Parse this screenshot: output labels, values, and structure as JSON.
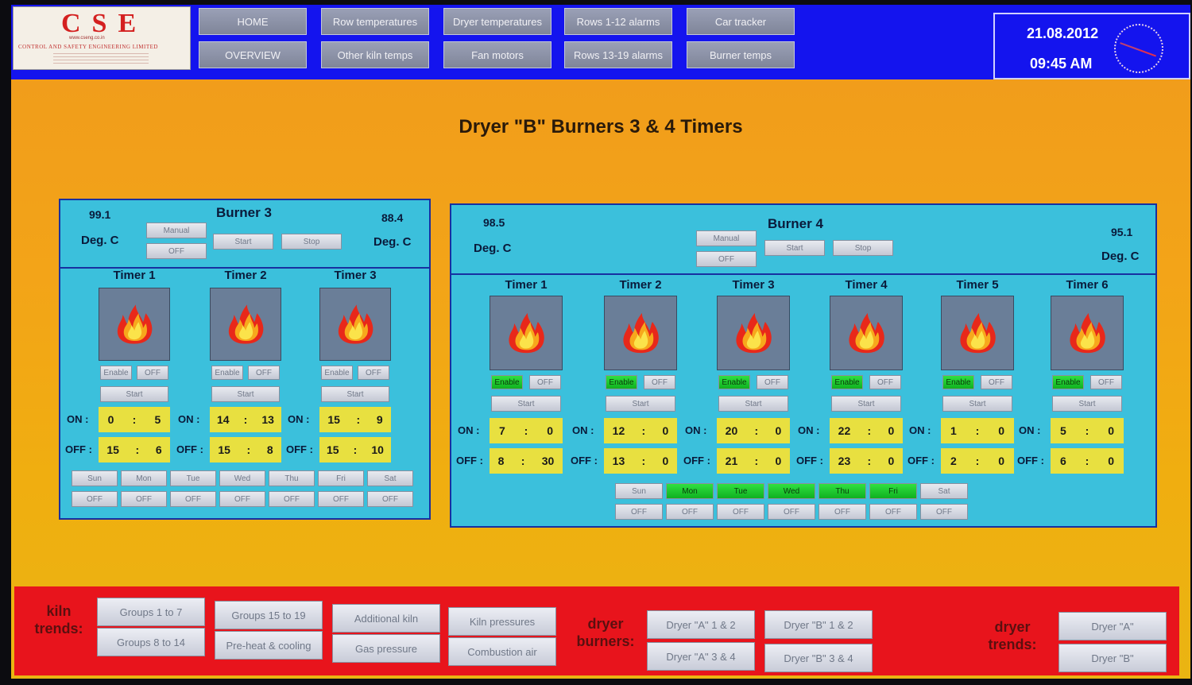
{
  "logo": {
    "letters": "CSE",
    "url": "www.cseng.co.in",
    "company": "CONTROL AND SAFETY ENGINEERING LIMITED"
  },
  "nav": [
    {
      "label": "HOME"
    },
    {
      "label": "Row temperatures"
    },
    {
      "label": "Dryer temperatures"
    },
    {
      "label": "Rows 1-12 alarms"
    },
    {
      "label": "Car tracker"
    },
    {
      "label": "OVERVIEW"
    },
    {
      "label": "Other kiln temps"
    },
    {
      "label": "Fan motors"
    },
    {
      "label": "Rows 13-19 alarms"
    },
    {
      "label": "Burner temps"
    }
  ],
  "clock": {
    "date": "21.08.2012",
    "time": "09:45 AM"
  },
  "page_title": "Dryer \"B\" Burners 3 & 4 Timers",
  "labels": {
    "on": "ON :",
    "off": "OFF :",
    "colon": ":",
    "deg": "Deg. C",
    "manual": "Manual",
    "off_btn": "OFF",
    "start": "Start",
    "stop": "Stop",
    "enable": "Enable"
  },
  "burner3": {
    "title": "Burner 3",
    "temp_left": "99.1",
    "temp_right": "88.4",
    "timers": [
      {
        "name": "Timer 1",
        "on_h": "0",
        "on_m": "5",
        "off_h": "15",
        "off_m": "6"
      },
      {
        "name": "Timer 2",
        "on_h": "14",
        "on_m": "13",
        "off_h": "15",
        "off_m": "8"
      },
      {
        "name": "Timer 3",
        "on_h": "15",
        "on_m": "9",
        "off_h": "15",
        "off_m": "10"
      }
    ],
    "days": [
      {
        "day": "Sun",
        "active": false
      },
      {
        "day": "Mon",
        "active": false
      },
      {
        "day": "Tue",
        "active": false
      },
      {
        "day": "Wed",
        "active": false
      },
      {
        "day": "Thu",
        "active": false
      },
      {
        "day": "Fri",
        "active": false
      },
      {
        "day": "Sat",
        "active": false
      }
    ]
  },
  "burner4": {
    "title": "Burner 4",
    "temp_left": "98.5",
    "temp_right": "95.1",
    "timers": [
      {
        "name": "Timer 1",
        "on_h": "7",
        "on_m": "0",
        "off_h": "8",
        "off_m": "30"
      },
      {
        "name": "Timer 2",
        "on_h": "12",
        "on_m": "0",
        "off_h": "13",
        "off_m": "0"
      },
      {
        "name": "Timer 3",
        "on_h": "20",
        "on_m": "0",
        "off_h": "21",
        "off_m": "0"
      },
      {
        "name": "Timer 4",
        "on_h": "22",
        "on_m": "0",
        "off_h": "23",
        "off_m": "0"
      },
      {
        "name": "Timer 5",
        "on_h": "1",
        "on_m": "0",
        "off_h": "2",
        "off_m": "0"
      },
      {
        "name": "Timer 6",
        "on_h": "5",
        "on_m": "0",
        "off_h": "6",
        "off_m": "0"
      }
    ],
    "days": [
      {
        "day": "Sun",
        "active": false
      },
      {
        "day": "Mon",
        "active": true
      },
      {
        "day": "Tue",
        "active": true
      },
      {
        "day": "Wed",
        "active": true
      },
      {
        "day": "Thu",
        "active": true
      },
      {
        "day": "Fri",
        "active": true
      },
      {
        "day": "Sat",
        "active": false
      }
    ]
  },
  "bottom": {
    "kiln_trends": "kiln\ntrends:",
    "dryer_burners": "dryer\nburners:",
    "dryer_trends": "dryer\ntrends:",
    "kiln_buttons": [
      "Groups 1 to 7",
      "Groups 8 to 14",
      "Groups 15 to 19",
      "Pre-heat & cooling",
      "Additional kiln",
      "Gas pressure",
      "Kiln pressures",
      "Combustion air"
    ],
    "burner_buttons": [
      "Dryer \"A\" 1 & 2",
      "Dryer \"A\" 3 & 4",
      "Dryer \"B\" 1 & 2",
      "Dryer \"B\" 3 & 4"
    ],
    "trend_buttons": [
      "Dryer \"A\"",
      "Dryer \"B\""
    ]
  },
  "colors": {
    "topbar": "#1414ee",
    "bottombar": "#e8141c",
    "panel": "#3bc0dc",
    "field": "#e8e040",
    "enable_green": "#20c830"
  }
}
